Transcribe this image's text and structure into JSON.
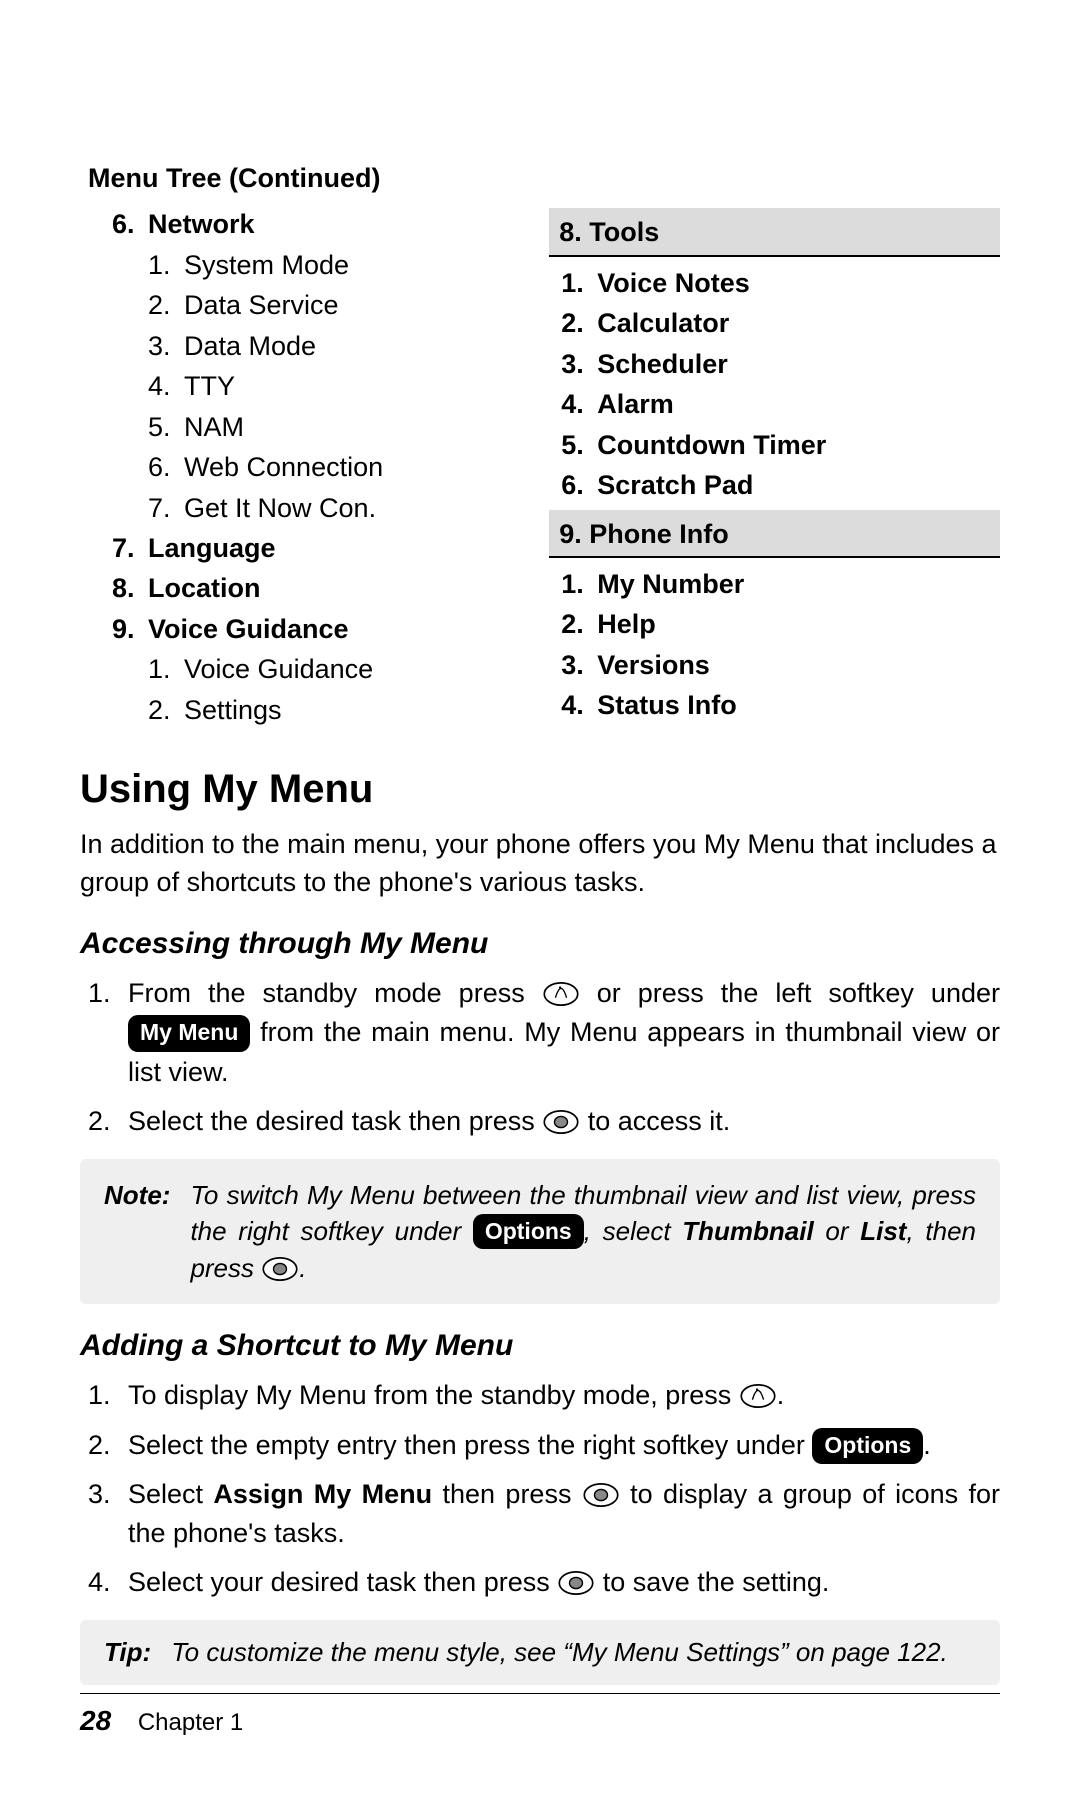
{
  "menuTree": {
    "heading": "Menu Tree (Continued)",
    "left": [
      {
        "n": "6.",
        "t": "Network",
        "bold": true,
        "sub": false
      },
      {
        "n": "1.",
        "t": "System Mode",
        "bold": false,
        "sub": true
      },
      {
        "n": "2.",
        "t": "Data Service",
        "bold": false,
        "sub": true
      },
      {
        "n": "3.",
        "t": "Data Mode",
        "bold": false,
        "sub": true
      },
      {
        "n": "4.",
        "t": "TTY",
        "bold": false,
        "sub": true
      },
      {
        "n": "5.",
        "t": "NAM",
        "bold": false,
        "sub": true
      },
      {
        "n": "6.",
        "t": "Web Connection",
        "bold": false,
        "sub": true
      },
      {
        "n": "7.",
        "t": "Get It Now Con.",
        "bold": false,
        "sub": true
      },
      {
        "n": "7.",
        "t": "Language",
        "bold": true,
        "sub": false
      },
      {
        "n": "8.",
        "t": "Location",
        "bold": true,
        "sub": false
      },
      {
        "n": "9.",
        "t": "Voice Guidance",
        "bold": true,
        "sub": false
      },
      {
        "n": "1.",
        "t": "Voice Guidance",
        "bold": false,
        "sub": true
      },
      {
        "n": "2.",
        "t": "Settings",
        "bold": false,
        "sub": true
      }
    ],
    "right": {
      "sections": [
        {
          "header": "8. Tools",
          "items": [
            {
              "n": "1.",
              "t": "Voice Notes"
            },
            {
              "n": "2.",
              "t": "Calculator"
            },
            {
              "n": "3.",
              "t": "Scheduler"
            },
            {
              "n": "4.",
              "t": "Alarm"
            },
            {
              "n": "5.",
              "t": "Countdown Timer"
            },
            {
              "n": "6.",
              "t": "Scratch Pad"
            }
          ]
        },
        {
          "header": "9. Phone Info",
          "items": [
            {
              "n": "1.",
              "t": "My Number"
            },
            {
              "n": "2.",
              "t": "Help"
            },
            {
              "n": "3.",
              "t": "Versions"
            },
            {
              "n": "4.",
              "t": "Status Info"
            }
          ]
        }
      ]
    }
  },
  "h1": "Using My Menu",
  "intro": "In addition to the main menu, your phone offers you My Menu that includes a group of shortcuts to the phone's various tasks.",
  "accessing": {
    "title": "Accessing through My Menu",
    "step1a": "From the standby mode press ",
    "step1b": " or press the left softkey un­der ",
    "step1_pill": "My Menu",
    "step1c": " from the main menu. My Menu appears in thumb­nail view or list view.",
    "step2a": "Select the desired task then press ",
    "step2b": " to access it."
  },
  "note": {
    "label": "Note:",
    "a": "To switch My Menu between the thumbnail view and list view, press the right softkey under ",
    "pill": "Options",
    "b": ", select ",
    "bold1": "Thumbnail",
    "c": " or ",
    "bold2": "List",
    "d": ", then press ",
    "e": "."
  },
  "adding": {
    "title": "Adding a Shortcut to My Menu",
    "s1a": "To display My Menu from the standby mode, press ",
    "s1b": ".",
    "s2a": "Select the empty entry then press the right softkey under ",
    "s2_pill": "Options",
    "s2b": ".",
    "s3a": "Select ",
    "s3_bold": "Assign My Menu",
    "s3b": " then press ",
    "s3c": " to display a group of icons for the phone's tasks.",
    "s4a": "Select your desired task then press ",
    "s4b": " to save the setting."
  },
  "tip": {
    "label": "Tip:",
    "text": "To customize the menu style, see “My Menu Settings” on page 122."
  },
  "footer": {
    "page": "28",
    "chapter": "Chapter 1"
  }
}
